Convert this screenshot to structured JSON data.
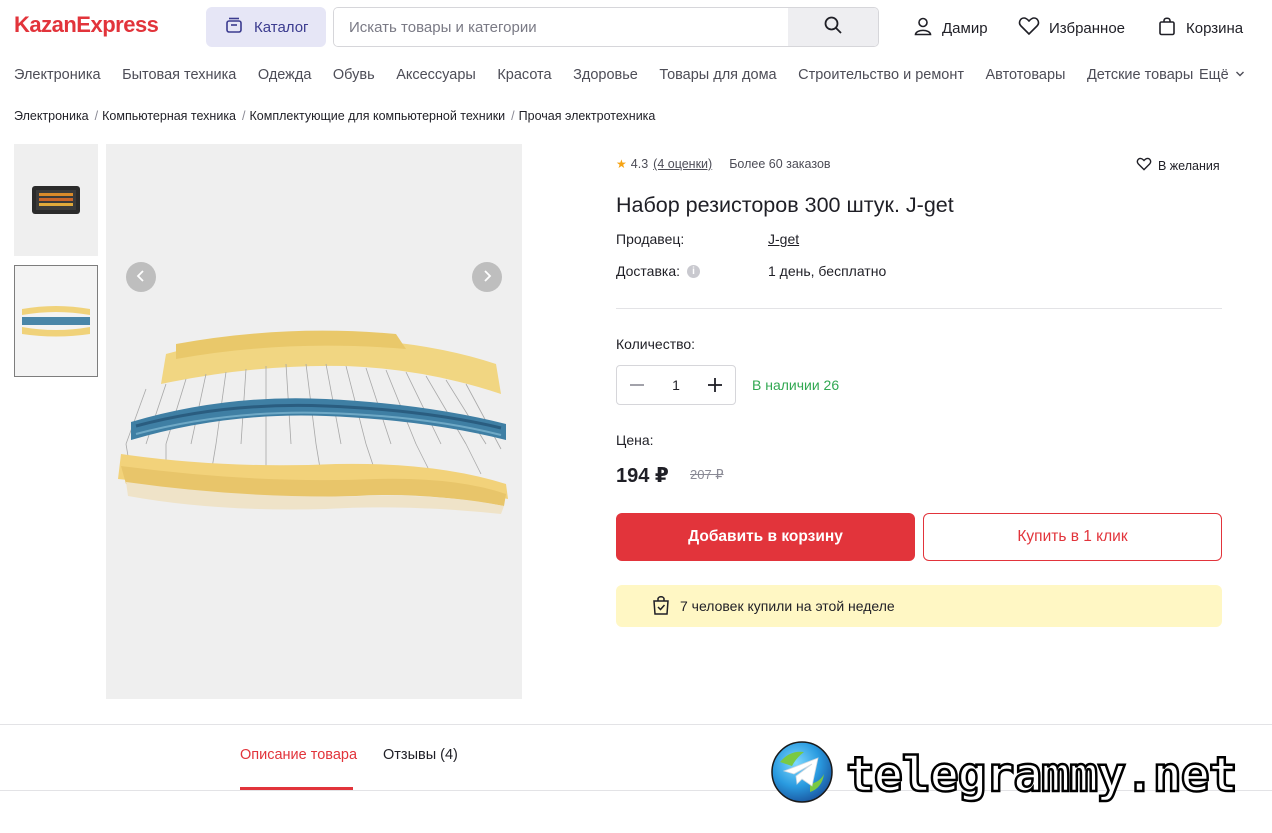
{
  "header": {
    "logo": "KazanExpress",
    "catalog_label": "Каталог",
    "search_placeholder": "Искать товары и категории",
    "user_label": "Дамир",
    "favorites_label": "Избранное",
    "cart_label": "Корзина"
  },
  "categories": [
    "Электроника",
    "Бытовая техника",
    "Одежда",
    "Обувь",
    "Аксессуары",
    "Красота",
    "Здоровье",
    "Товары для дома",
    "Строительство и ремонт",
    "Автотовары",
    "Детские товары"
  ],
  "more_label": "Ещё",
  "breadcrumb": [
    "Электроника",
    "Компьютерная техника",
    "Комплектующие для компьютерной техники",
    "Прочая электротехника"
  ],
  "product": {
    "rating": "4.3",
    "reviews": "(4 оценки)",
    "orders": "Более 60 заказов",
    "wishlist_label": "В желания",
    "title": "Набор резисторов 300 штук. J-get",
    "seller_label": "Продавец:",
    "seller": "J-get",
    "delivery_label": "Доставка:",
    "delivery": "1 день, бесплатно",
    "quantity_label": "Количество:",
    "quantity": "1",
    "stock": "В наличии 26",
    "price_label": "Цена:",
    "price": "194 ₽",
    "old_price": "207 ₽",
    "add_to_cart": "Добавить в корзину",
    "buy_one_click": "Купить в 1 клик",
    "notice": "7 человек купили на этой неделе"
  },
  "tabs": {
    "description": "Описание товара",
    "reviews": "Отзывы (4)"
  },
  "watermark": "telegrammy.net",
  "colors": {
    "brand": "#e2343b",
    "stock": "#32a852",
    "notice_bg": "#fff7c4",
    "star": "#f6a313"
  }
}
